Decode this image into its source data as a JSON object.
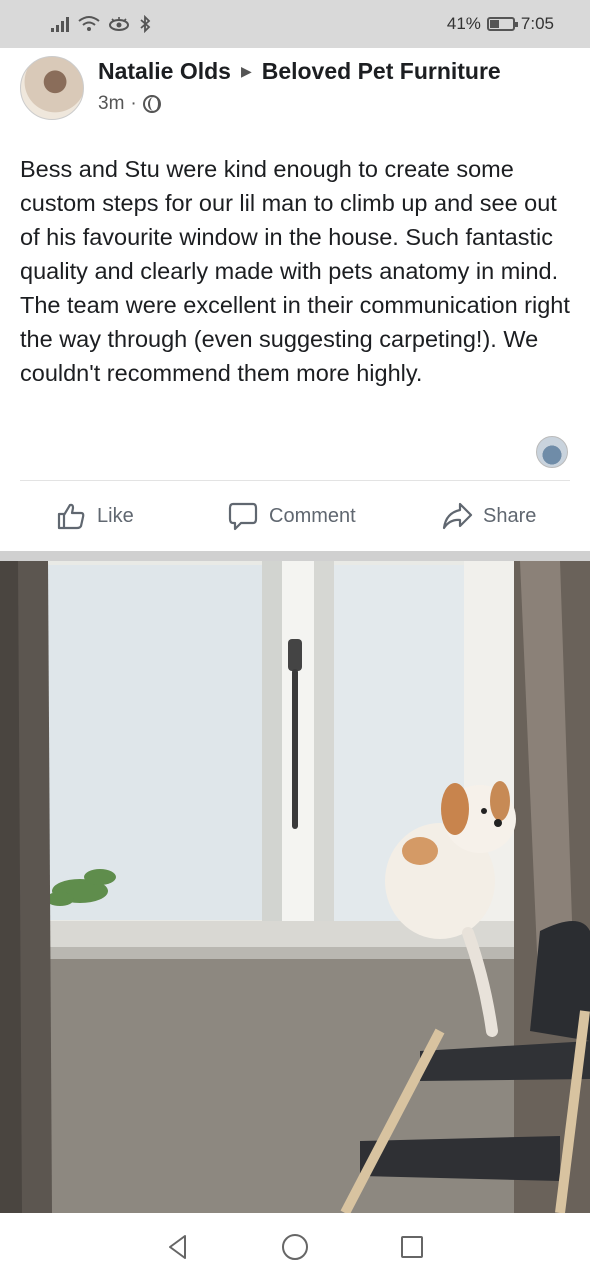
{
  "status_bar": {
    "battery_percent": "41%",
    "battery_level": 0.41,
    "time": "7:05",
    "icons": [
      "signal-icon",
      "wifi-icon",
      "eye-icon",
      "bluetooth-icon"
    ]
  },
  "post": {
    "author": "Natalie Olds",
    "page": "Beloved Pet Furniture",
    "time_ago": "3m",
    "separator": "·",
    "privacy_icon": "globe-icon",
    "text": "Bess and Stu were kind enough to create some custom steps for our lil man to climb up and see out of his favourite window in the house. Such fantastic quality and clearly made with pets anatomy in mind. The team were excellent in their communication right the way through (even suggesting carpeting!). We couldn't recommend them more highly."
  },
  "actions": {
    "like": "Like",
    "comment": "Comment",
    "share": "Share"
  },
  "nav": {
    "icons": [
      "back-icon",
      "home-icon",
      "recents-icon"
    ]
  },
  "colors": {
    "status_bar_bg": "#d9d9d9",
    "action_text": "#606770",
    "separator": "#d0d0d0"
  }
}
